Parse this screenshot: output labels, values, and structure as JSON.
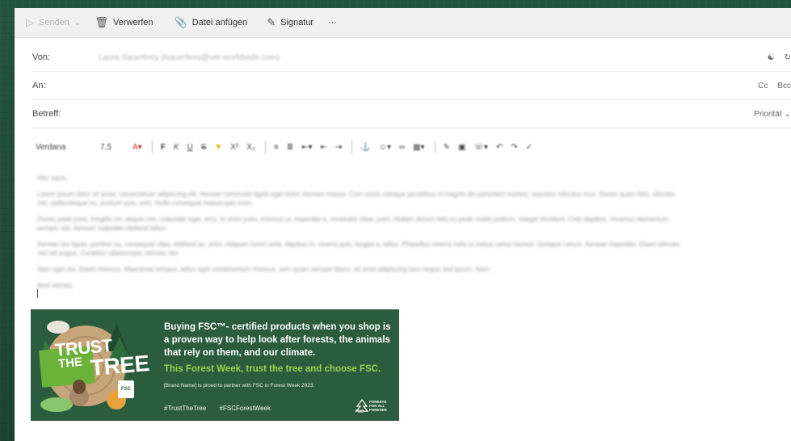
{
  "toolbar": {
    "send_label": "Senden",
    "discard_label": "Verwerfen",
    "attach_label": "Datei anfügen",
    "signature_label": "Signatur",
    "more_label": "···"
  },
  "header": {
    "from_label": "Von:",
    "from_value": "Laura Sauerbrey (lsauerbrey@ver-worldwide.com)",
    "to_label": "An:",
    "cc_label": "Cc",
    "bcc_label": "Bcc",
    "subject_label": "Betreff:",
    "priority_label": "Priorität"
  },
  "format": {
    "font_name": "Verdana",
    "font_size": "7,5"
  },
  "body": {
    "greeting": "Hier sacis,",
    "p1": "Lorem ipsum dolor sit amet, consectetuer adipiscing elit. Aenean commodo ligula eget dolor. Aenean massa. Cum sociis natoque penatibus et magnis dis parturient montes, nascetur ridiculus mus. Donec quam felis, ultricies nec, pellentesque eu, pretium quis, sem. Nulla consequat massa quis enim.",
    "p2": "Donec pede justo, fringilla vel, aliquet nec, vulputate eget, arcu. In enim justo, rhoncus ut, imperdiet a, venenatis vitae, justo. Nullam dictum felis eu pede mollis pretium. Integer tincidunt. Cras dapibus. Vivamus elementum semper nisi. Aenean vulputate eleifend tellus.",
    "p3": "Aenean leo ligula, porttitor eu, consequat vitae, eleifend ac, enim. Aliquam lorem ante, dapibus in, viverra quis, feugiat a, tellus. Phasellus viverra nulla ut metus varius laoreet. Quisque rutrum. Aenean imperdiet. Etiam ultricies nisi vel augue. Curabitur ullamcorper ultricies nisi.",
    "p4": "Nam eget dui. Etiam rhoncus. Maecenas tempus, tellus eget condimentum rhoncus, sem quam semper libero, sit amet adipiscing sem neque sed ipsum. Nam.",
    "signoff": "Best wishes,"
  },
  "banner": {
    "trust_word": "TRUST",
    "the_word": "THE",
    "tree_word": "TREE",
    "main_text": "Buying FSC™- certified products when you shop is a proven way to help look after forests, the animals that rely on them, and our climate.",
    "green_text": "This Forest Week, trust the tree and choose FSC.",
    "partner_text": "[Brand Name] is proud to partner with FSC in Forest Week 2023.",
    "hashtag1": "#TrustTheTree",
    "hashtag2": "#FSCForestWeek",
    "fsc_tagline": "FORESTS FOR ALL FOREVER",
    "fsc_label": "FSC",
    "badge_label": "FSC"
  },
  "colors": {
    "banner_bg": "#2b5c3e",
    "accent_green": "#9bd14a",
    "background": "#1f4a36"
  }
}
